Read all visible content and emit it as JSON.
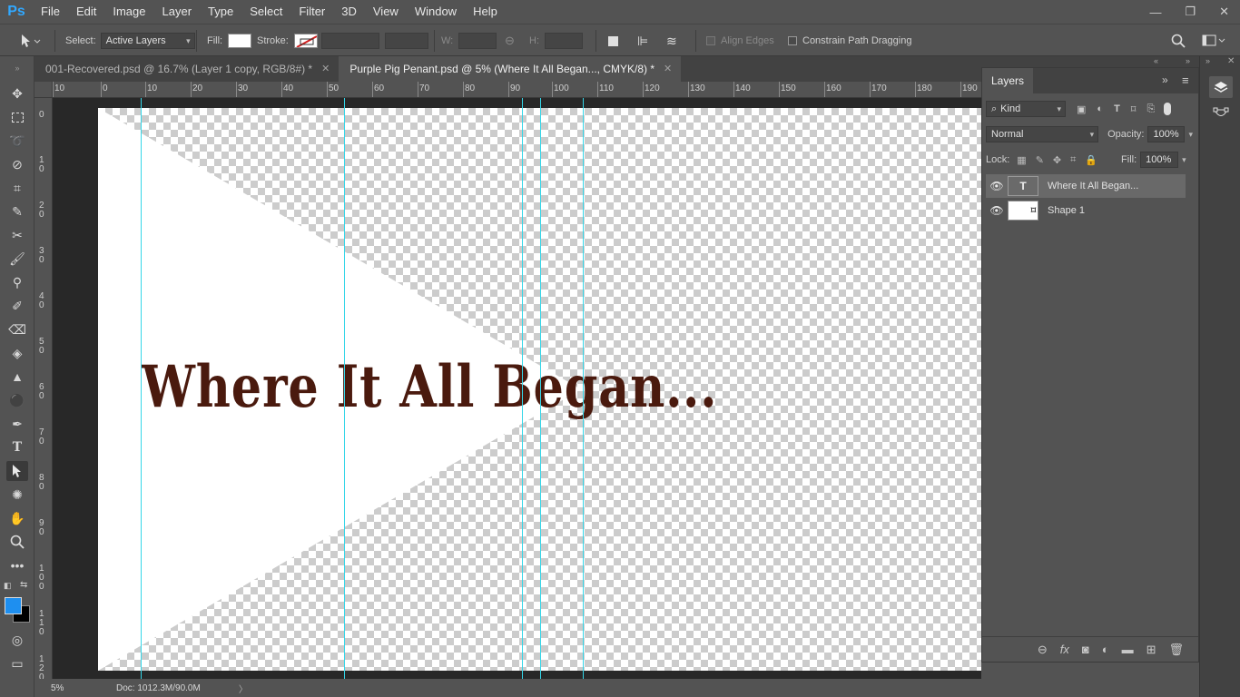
{
  "app": {
    "logo": "Ps"
  },
  "menu": [
    "File",
    "Edit",
    "Image",
    "Layer",
    "Type",
    "Select",
    "Filter",
    "3D",
    "View",
    "Window",
    "Help"
  ],
  "window_controls": {
    "minimize": "—",
    "restore": "❐",
    "close": "✕"
  },
  "options_bar": {
    "select_label": "Select:",
    "select_value": "Active Layers",
    "fill_label": "Fill:",
    "stroke_label": "Stroke:",
    "w_label": "W:",
    "h_label": "H:",
    "align_edges_label": "Align Edges",
    "constrain_label": "Constrain Path Dragging"
  },
  "tabs": [
    {
      "label": "001-Recovered.psd @ 16.7% (Layer 1 copy, RGB/8#) *",
      "active": false
    },
    {
      "label": "Purple Pig Penant.psd @ 5% (Where It All Began..., CMYK/8) *",
      "active": true
    }
  ],
  "ruler_h_labels": [
    "10",
    "0",
    "10",
    "20",
    "30",
    "40",
    "50",
    "60",
    "70",
    "80",
    "90",
    "100",
    "110",
    "120",
    "130",
    "140",
    "150",
    "160",
    "170",
    "180",
    "190"
  ],
  "ruler_v_labels": [
    "0",
    "10",
    "20",
    "30",
    "40",
    "50",
    "60",
    "70",
    "80",
    "90",
    "100",
    "110",
    "120"
  ],
  "canvas": {
    "pennant_text": "Where It All Began...",
    "text_color": "#4a1a0e",
    "guide_color": "#35d6e8"
  },
  "status": {
    "zoom": "5%",
    "doc": "Doc: 1012.3M/90.0M",
    "arrow": "〉"
  },
  "layers_panel": {
    "title": "Layers",
    "filter_kind": "Kind",
    "blend_mode": "Normal",
    "opacity_label": "Opacity:",
    "opacity_value": "100%",
    "lock_label": "Lock:",
    "fill_label": "Fill:",
    "fill_value": "100%",
    "layers": [
      {
        "name": "Where It All Began...",
        "type": "text",
        "selected": true
      },
      {
        "name": "Shape 1",
        "type": "shape",
        "selected": false
      }
    ]
  },
  "colors": {
    "accent": "#31a8ff",
    "foreground": "#1e8ff0",
    "background": "#000000"
  }
}
